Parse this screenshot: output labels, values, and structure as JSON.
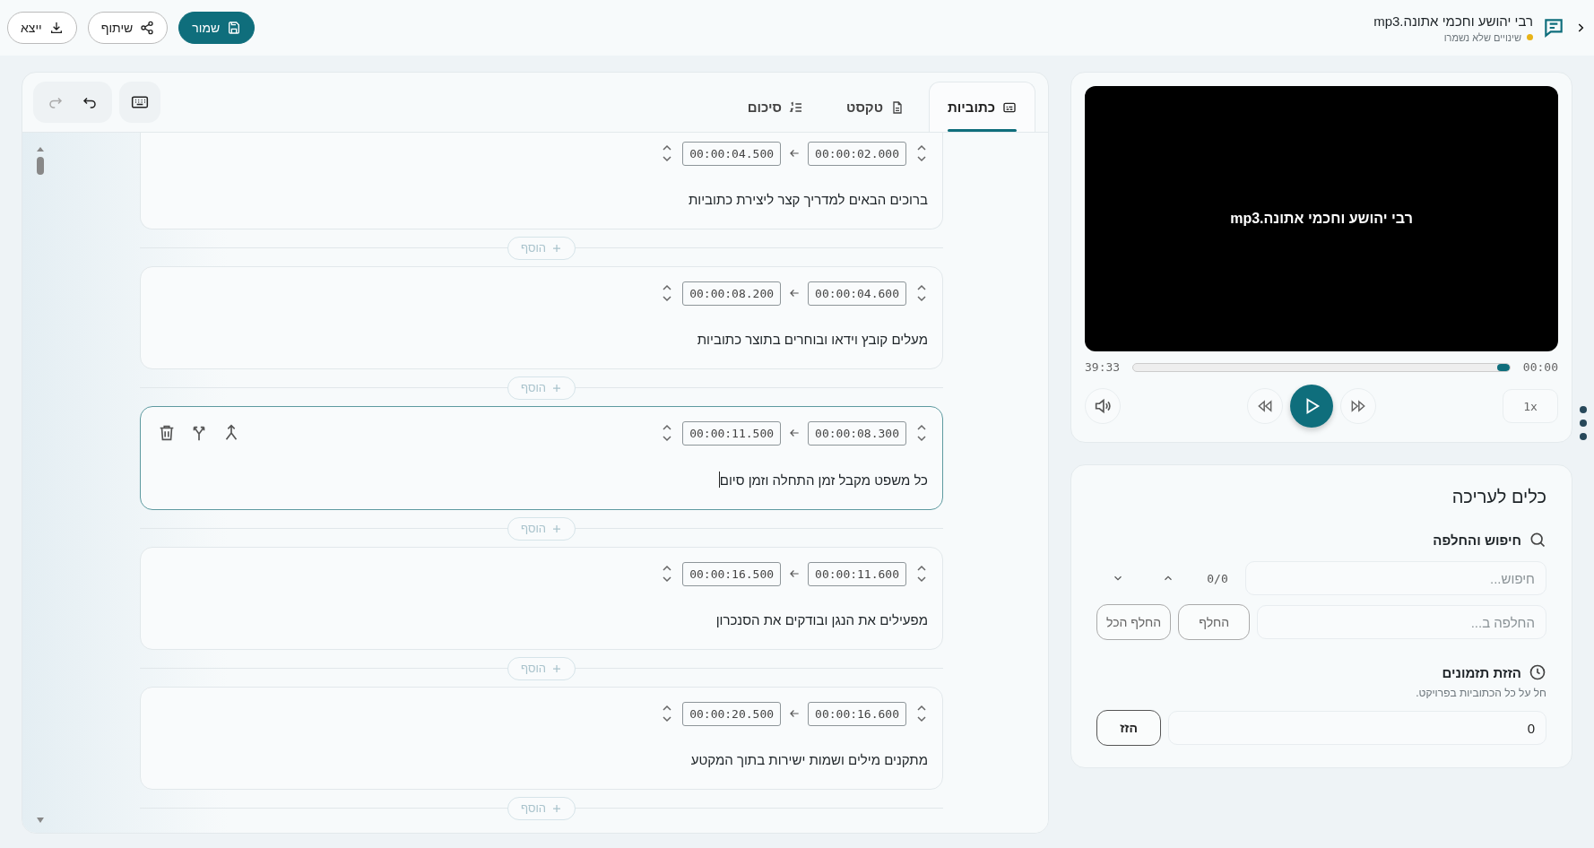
{
  "header": {
    "title": "רבי יהושע וחכמי אתונה.mp3",
    "status": "שינויים שלא נשמרו",
    "unsaved": true
  },
  "actions": [
    {
      "kind": "save",
      "label": "שמור"
    },
    {
      "kind": "share",
      "label": "שיתוף"
    },
    {
      "kind": "export",
      "label": "ייצא"
    }
  ],
  "editor": {
    "tabs": [
      {
        "kind": "subtitles",
        "label": "כתוביות",
        "selected": true
      },
      {
        "kind": "text",
        "label": "טקסט",
        "selected": false
      },
      {
        "kind": "summary",
        "label": "סיכום",
        "selected": false
      }
    ],
    "history": {
      "undo_disabled": false,
      "redo_disabled": true
    },
    "subtitles": [
      {
        "start": "00:00:02.000",
        "end": "00:00:04.500",
        "text": "ברוכים הבאים למדריך קצר ליצירת כתוביות",
        "active": false,
        "add_label": "הוסף"
      },
      {
        "start": "00:00:04.600",
        "end": "00:00:08.200",
        "text": "מעלים קובץ וידאו ובוחרים בתוצר כתוביות",
        "active": false,
        "add_label": "הוסף"
      },
      {
        "start": "00:00:08.300",
        "end": "00:00:11.500",
        "text": "כל משפט מקבל זמן התחלה וזמן סיום",
        "active": true,
        "add_label": "הוסף"
      },
      {
        "start": "00:00:11.600",
        "end": "00:00:16.500",
        "text": "מפעילים את הנגן ובודקים את הסנכרון",
        "active": false,
        "add_label": "הוסף"
      },
      {
        "start": "00:00:16.600",
        "end": "00:00:20.500",
        "text": "מתקנים מילים ושמות ישירות בתוך המקטע",
        "active": false,
        "add_label": "הוסף"
      }
    ]
  },
  "player": {
    "video_title": "רבי יהושע וחכמי אתונה.mp3",
    "duration": "39:33",
    "current": "00:00",
    "level": 0.03,
    "speed": "1x"
  },
  "tools": {
    "title": "כלים לעריכה",
    "search": {
      "heading": "חיפוש והחלפה",
      "placeholder": "חיפוש...",
      "count": "0/0",
      "replace_placeholder": "החלפה ב...",
      "replace_label": "החלף",
      "replace_all_label": "החלף הכל"
    },
    "shift": {
      "heading": "הזזת תזמונים",
      "description": "חל על כל הכתוביות בפרויקט.",
      "value": "0",
      "button": "הזז"
    }
  }
}
